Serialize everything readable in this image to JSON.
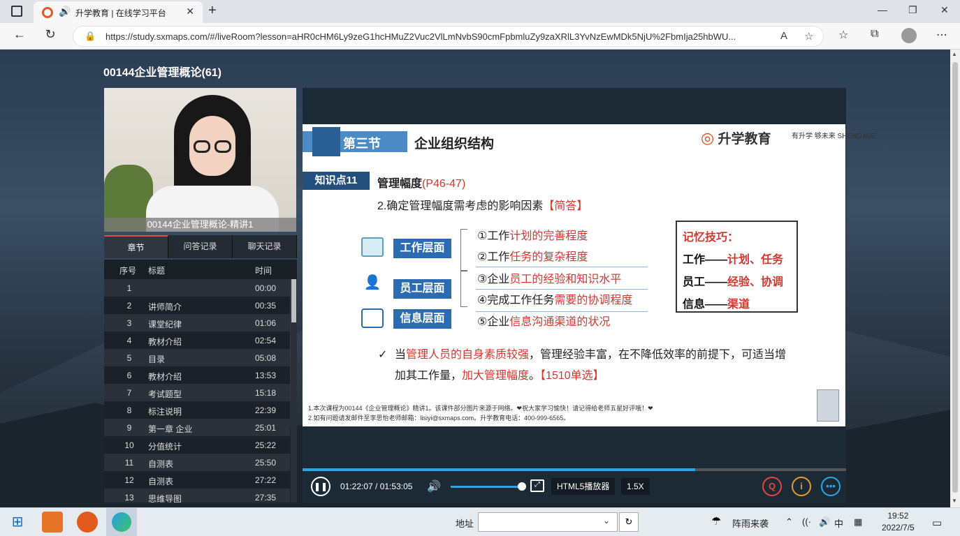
{
  "browser": {
    "tab_title": "升学教育 | 在线学习平台",
    "url": "https://study.sxmaps.com/#/liveRoom?lesson=aHR0cHM6Ly9zeG1hcHMuZ2Vuc2VlLmNvbS90cmFpbmluZy9zaXRlL3YvNzEwMDk5NjU%2FbmIja25hbWU...",
    "new_tab_glyph": "+",
    "close_glyph": "✕"
  },
  "page": {
    "course_title": "00144企业管理概论(61)",
    "teacher_caption": "00144企业管理概论-精讲1",
    "tabs": [
      "章节",
      "问答记录",
      "聊天记录"
    ],
    "list_headers": {
      "index": "序号",
      "title": "标题",
      "time": "时间"
    },
    "chapters": [
      {
        "n": "1",
        "title": "",
        "time": "00:00"
      },
      {
        "n": "2",
        "title": "讲师简介",
        "time": "00:35"
      },
      {
        "n": "3",
        "title": "课堂纪律",
        "time": "01:06"
      },
      {
        "n": "4",
        "title": "教材介绍",
        "time": "02:54"
      },
      {
        "n": "5",
        "title": "目录",
        "time": "05:08"
      },
      {
        "n": "6",
        "title": "教材介绍",
        "time": "13:53"
      },
      {
        "n": "7",
        "title": "考试题型",
        "time": "15:18"
      },
      {
        "n": "8",
        "title": "标注说明",
        "time": "22:39"
      },
      {
        "n": "9",
        "title": "第一章 企业",
        "time": "25:01"
      },
      {
        "n": "10",
        "title": "分值统计",
        "time": "25:22"
      },
      {
        "n": "11",
        "title": "自测表",
        "time": "25:50"
      },
      {
        "n": "12",
        "title": "自测表",
        "time": "27:22"
      },
      {
        "n": "13",
        "title": "思维导图",
        "time": "27:35"
      }
    ]
  },
  "slide": {
    "section": "第三节",
    "section_title": "企业组织结构",
    "logo": "升学教育",
    "logo_slogan": "有升学 够未来 SHENGXUE",
    "kp_label": "知识点11",
    "kp_title": "管理幅度",
    "kp_pages": "(P46-47)",
    "subtitle": "2.确定管理幅度需考虑的影响因素",
    "subtitle_tag": "【简答】",
    "layers": [
      "工作层面",
      "员工层面",
      "信息层面"
    ],
    "items": [
      {
        "pre": "①工作",
        "red": "计划的完善程度",
        "post": ""
      },
      {
        "pre": "②工作",
        "red": "任务的复杂程度",
        "post": ""
      },
      {
        "pre": "③企业",
        "red": "员工的经验和知识水平",
        "post": ""
      },
      {
        "pre": "④完成工作任务",
        "red": "需要的协调程度",
        "post": ""
      },
      {
        "pre": "⑤企业",
        "red": "信息沟通渠道的状况",
        "post": ""
      }
    ],
    "memo_title": "记忆技巧：",
    "memo_lines": [
      {
        "k": "工作——",
        "v": "计划、任务"
      },
      {
        "k": "员工——",
        "v": "经验、协调"
      },
      {
        "k": "信息——",
        "v": "渠道"
      }
    ],
    "note_check": "✓",
    "note_a": "当",
    "note_red1": "管理人员的自身素质较强",
    "note_b": "，管理经验丰富，在不降低效率的前提下，可适当增加其工作量，",
    "note_red2": "加大管理幅度",
    "note_c": "。",
    "note_tag": "【1510单选】",
    "footnote1": "1.本次课程为00144《企业管理概论》精讲1。该课件部分图片来源于网络。❤祝大家学习愉快！请记得给老师五星好评哦！❤",
    "footnote2": "2.如有问题请发邮件至李思怡老师邮箱：lisiyi@sxmaps.com。升学教育电话：400-999-6565。"
  },
  "player": {
    "time": "01:22:07 / 01:53:05",
    "progress": 0.723,
    "volume": 0.95,
    "player_label": "HTML5播放器",
    "speed": "1.5X"
  },
  "taskbar": {
    "addr_label": "地址",
    "weather": "阵雨来袭",
    "ime": "中",
    "time": "19:52",
    "date": "2022/7/5"
  }
}
